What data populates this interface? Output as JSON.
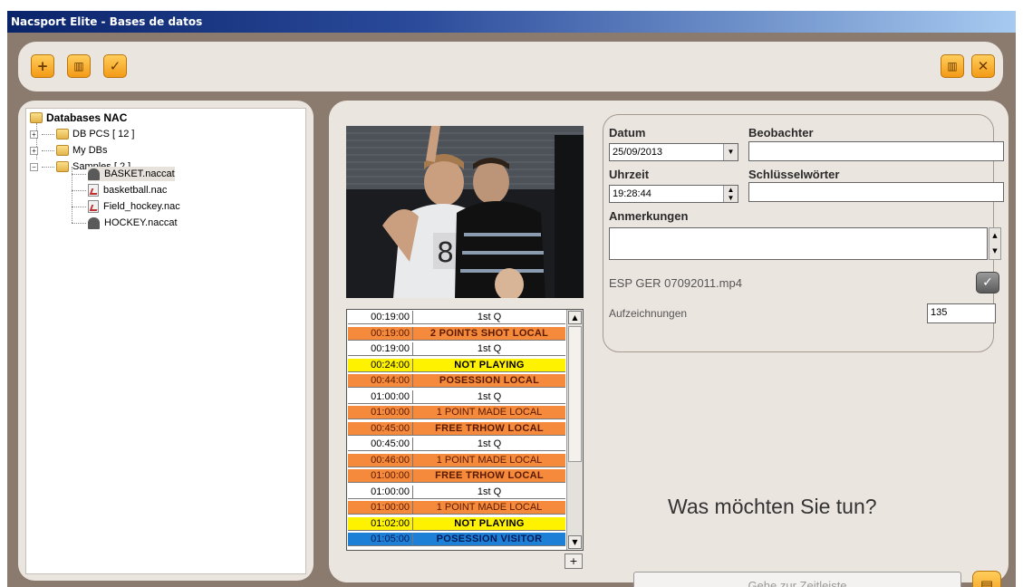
{
  "window": {
    "title": "Nacsport Elite - Bases de datos"
  },
  "toolbar": {
    "add_icon": "plus-icon",
    "delete_icon": "trash-icon",
    "confirm_icon": "check-icon",
    "right_delete_icon": "trash-icon",
    "close_icon": "close-icon",
    "accent_color": "#f39a16"
  },
  "tree": {
    "root": "Databases NAC",
    "items": [
      {
        "label": "DB PCS [ 12 ]",
        "expander": "+"
      },
      {
        "label": "My DBs",
        "expander": "+"
      },
      {
        "label": "Samples [ 2 ]",
        "expander": "−"
      }
    ],
    "children": [
      {
        "label": "BASKET.naccat",
        "icon": "category-icon"
      },
      {
        "label": "basketball.nac",
        "icon": "file-icon"
      },
      {
        "label": "Field_hockey.nac",
        "icon": "file-icon"
      },
      {
        "label": "HOCKEY.naccat",
        "icon": "category-icon"
      }
    ]
  },
  "events": [
    {
      "time": "00:19:00",
      "label": "1st Q",
      "color": "white",
      "bold": false
    },
    {
      "time": "00:19:00",
      "label": "2 POINTS SHOT LOCAL",
      "color": "orange",
      "bold": true
    },
    {
      "time": "00:19:00",
      "label": "1st Q",
      "color": "white",
      "bold": false
    },
    {
      "time": "00:24:00",
      "label": "NOT PLAYING",
      "color": "yellow",
      "bold": true
    },
    {
      "time": "00:44:00",
      "label": "POSESSION LOCAL",
      "color": "orange",
      "bold": true
    },
    {
      "time": "01:00:00",
      "label": "1st Q",
      "color": "white",
      "bold": false
    },
    {
      "time": "01:00:00",
      "label": "1 POINT MADE LOCAL",
      "color": "orange",
      "bold": false
    },
    {
      "time": "00:45:00",
      "label": "FREE TRHOW LOCAL",
      "color": "orange",
      "bold": true
    },
    {
      "time": "00:45:00",
      "label": "1st Q",
      "color": "white",
      "bold": false
    },
    {
      "time": "00:46:00",
      "label": "1 POINT MADE LOCAL",
      "color": "orange",
      "bold": false
    },
    {
      "time": "01:00:00",
      "label": "FREE TRHOW LOCAL",
      "color": "orange",
      "bold": true
    },
    {
      "time": "01:00:00",
      "label": "1st Q",
      "color": "white",
      "bold": false
    },
    {
      "time": "01:00:00",
      "label": "1 POINT MADE LOCAL",
      "color": "orange",
      "bold": false
    },
    {
      "time": "01:02:00",
      "label": "NOT PLAYING",
      "color": "yellow",
      "bold": true
    },
    {
      "time": "01:05:00",
      "label": "POSESSION VISITOR",
      "color": "blue",
      "bold": true
    }
  ],
  "list_controls": {
    "add_label": "+"
  },
  "form": {
    "date_label": "Datum",
    "date_value": "25/09/2013",
    "observer_label": "Beobachter",
    "observer_value": "",
    "time_label": "Uhrzeit",
    "time_value": "19:28:44",
    "keywords_label": "Schlüsselwörter",
    "keywords_value": "",
    "notes_label": "Anmerkungen",
    "notes_value": "",
    "video_file": "ESP GER 07092011.mp4",
    "recordings_label": "Aufzeichnungen",
    "recordings_value": "135"
  },
  "prompt": {
    "question": "Was möchten Sie tun?"
  },
  "actions": {
    "goto_timeline": "Gehe zur Zeitleiste"
  }
}
